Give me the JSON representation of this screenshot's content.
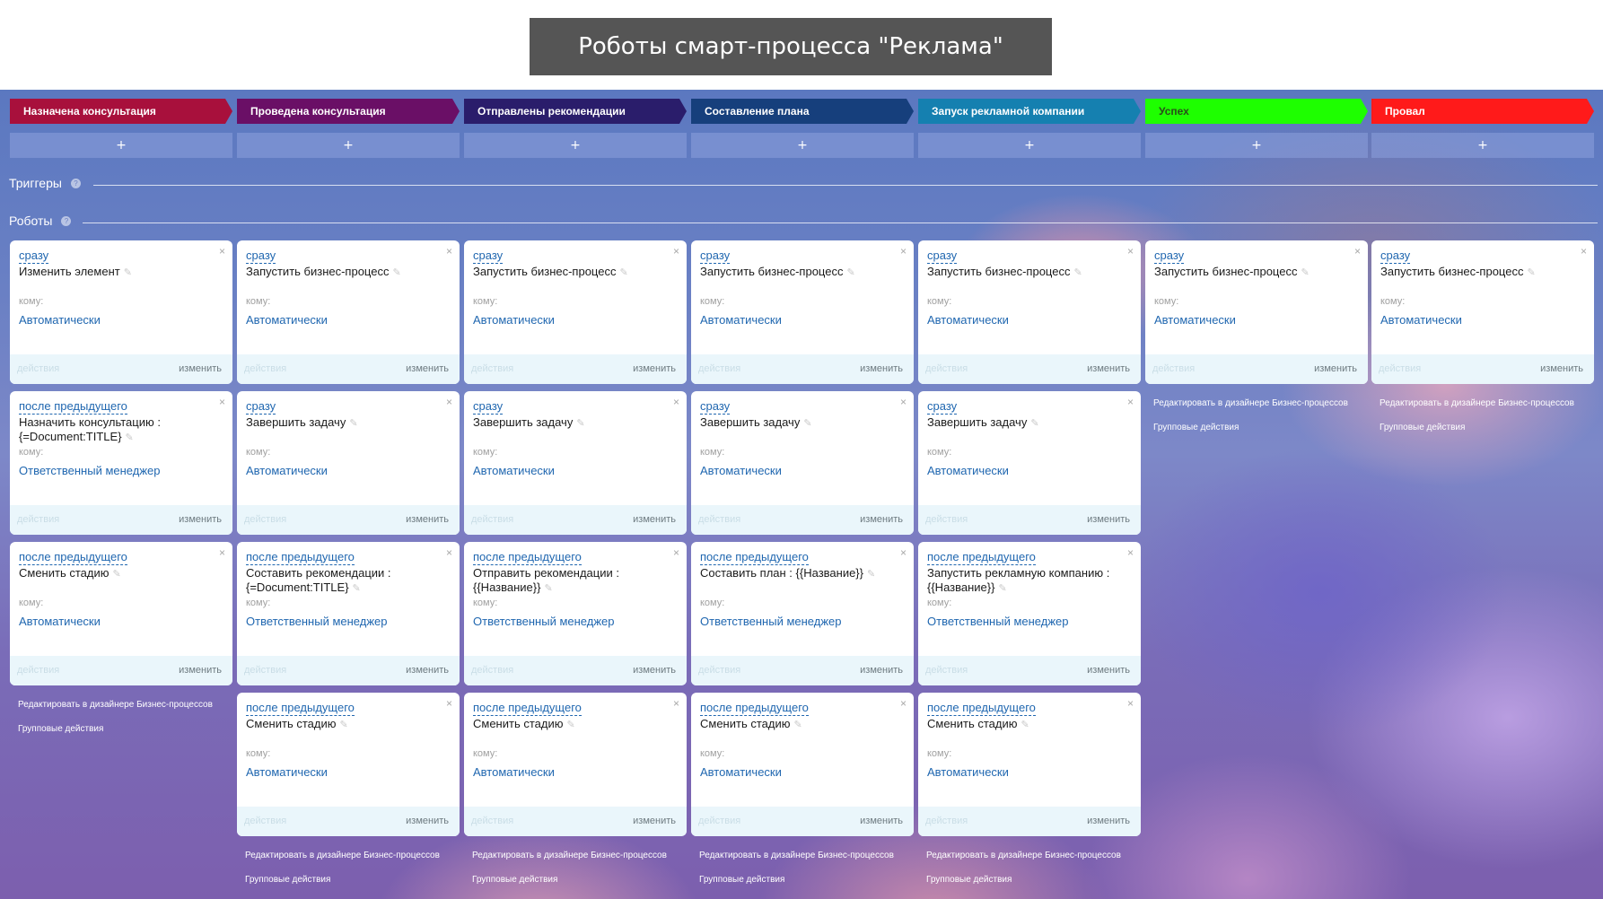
{
  "header": {
    "title": "Роботы смарт-процесса \"Реклама\""
  },
  "stages": [
    {
      "label": "Назначена консультация",
      "color": "#a8103c",
      "add": "+"
    },
    {
      "label": "Проведена консультация",
      "color": "#6a0f66",
      "add": "+"
    },
    {
      "label": "Отправлены рекомендации",
      "color": "#2a1d6b",
      "add": "+"
    },
    {
      "label": "Составление плана",
      "color": "#163f7c",
      "add": "+"
    },
    {
      "label": "Запуск рекламной компании",
      "color": "#1580b0",
      "add": "+"
    },
    {
      "label": "Успех",
      "color": "#1eff00",
      "add": "+"
    },
    {
      "label": "Провал",
      "color": "#ff1a1a",
      "add": "+"
    }
  ],
  "sections": {
    "triggers": "Триггеры",
    "robots": "Роботы"
  },
  "card_labels": {
    "to": "кому:",
    "actions": "действия",
    "edit": "изменить"
  },
  "column_links": {
    "designer": "Редактировать в дизайнере Бизнес-процессов",
    "group": "Групповые действия"
  },
  "robots": [
    [
      {
        "trigger": "сразу",
        "title": "Изменить элемент",
        "to": "Автоматически"
      },
      {
        "trigger": "после предыдущего",
        "title": "Назначить консультацию : {=Document:TITLE}",
        "to": "Ответственный менеджер"
      },
      {
        "trigger": "после предыдущего",
        "title": "Сменить стадию",
        "to": "Автоматически"
      }
    ],
    [
      {
        "trigger": "сразу",
        "title": "Запустить бизнес-процесс",
        "to": "Автоматически"
      },
      {
        "trigger": "сразу",
        "title": "Завершить задачу",
        "to": "Автоматически"
      },
      {
        "trigger": "после предыдущего",
        "title": "Составить рекомендации : {=Document:TITLE}",
        "to": "Ответственный менеджер"
      },
      {
        "trigger": "после предыдущего",
        "title": "Сменить стадию",
        "to": "Автоматически"
      }
    ],
    [
      {
        "trigger": "сразу",
        "title": "Запустить бизнес-процесс",
        "to": "Автоматически"
      },
      {
        "trigger": "сразу",
        "title": "Завершить задачу",
        "to": "Автоматически"
      },
      {
        "trigger": "после предыдущего",
        "title": "Отправить рекомендации : {{Название}}",
        "to": "Ответственный менеджер"
      },
      {
        "trigger": "после предыдущего",
        "title": "Сменить стадию",
        "to": "Автоматически"
      }
    ],
    [
      {
        "trigger": "сразу",
        "title": "Запустить бизнес-процесс",
        "to": "Автоматически"
      },
      {
        "trigger": "сразу",
        "title": "Завершить задачу",
        "to": "Автоматически"
      },
      {
        "trigger": "после предыдущего",
        "title": "Составить план : {{Название}}",
        "to": "Ответственный менеджер"
      },
      {
        "trigger": "после предыдущего",
        "title": "Сменить стадию",
        "to": "Автоматически"
      }
    ],
    [
      {
        "trigger": "сразу",
        "title": "Запустить бизнес-процесс",
        "to": "Автоматически"
      },
      {
        "trigger": "сразу",
        "title": "Завершить задачу",
        "to": "Автоматически"
      },
      {
        "trigger": "после предыдущего",
        "title": "Запустить рекламную компанию : {{Название}}",
        "to": "Ответственный менеджер"
      },
      {
        "trigger": "после предыдущего",
        "title": "Сменить стадию",
        "to": "Автоматически"
      }
    ],
    [
      {
        "trigger": "сразу",
        "title": "Запустить бизнес-процесс",
        "to": "Автоматически"
      }
    ],
    [
      {
        "trigger": "сразу",
        "title": "Запустить бизнес-процесс",
        "to": "Автоматически"
      }
    ]
  ]
}
